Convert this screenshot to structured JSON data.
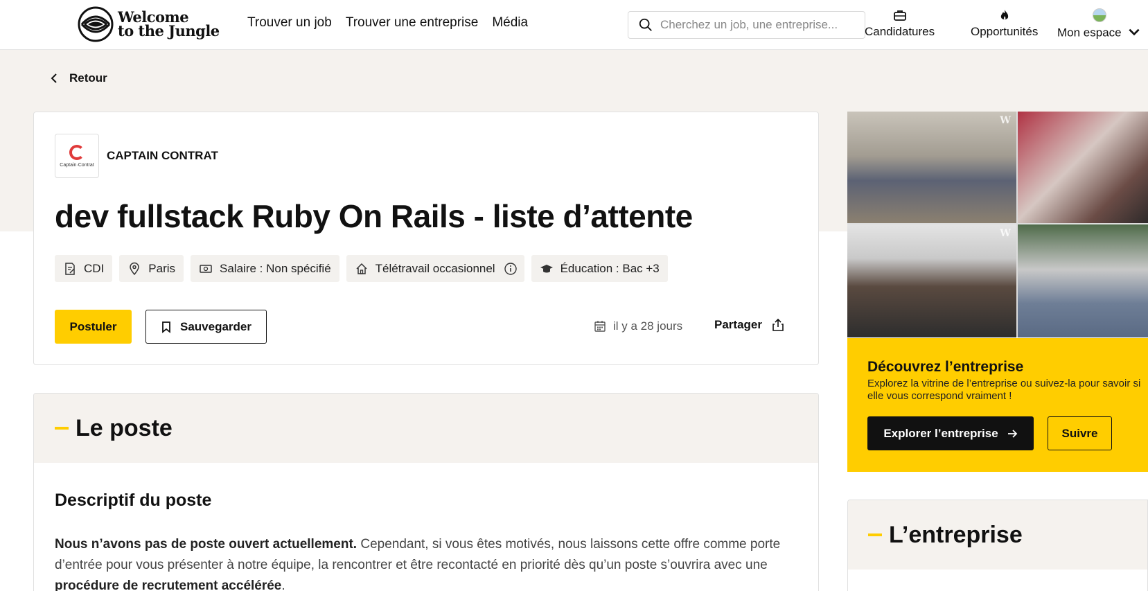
{
  "header": {
    "logo_line1": "Welcome",
    "logo_line2": "to the Jungle",
    "nav": [
      "Trouver un job",
      "Trouver une entreprise",
      "Média"
    ],
    "search_placeholder": "Cherchez un job, une entreprise...",
    "candidatures": "Candidatures",
    "opportunites": "Opportunités",
    "mon_espace": "Mon espace"
  },
  "back_label": "Retour",
  "job": {
    "company_name": "CAPTAIN CONTRAT",
    "company_logo_text": "Captain·Contrat",
    "title": "dev fullstack Ruby On Rails - liste d’attente",
    "tags": {
      "contract": "CDI",
      "location": "Paris",
      "salary": "Salaire :  Non spécifié",
      "remote": "Télétravail occasionnel",
      "education": "Éducation :  Bac +3"
    },
    "apply_label": "Postuler",
    "save_label": "Sauvegarder",
    "posted": "il y a 28 jours",
    "share_label": "Partager"
  },
  "poste": {
    "heading": "Le poste",
    "subheading": "Descriptif du poste",
    "para_bold": "Nous n’avons pas de poste ouvert actuellement.",
    "para_text": " Cependant, si vous êtes motivés, nous laissons cette offre comme porte d’entrée pour vous présenter à notre équipe, la rencontrer et être recontacté en priorité dès qu’un poste s’ouvrira avec une ",
    "para_bold2": "procédure de recrutement accélérée",
    "para_end": "."
  },
  "sidebar": {
    "discover_title": "Découvrez l’entreprise",
    "discover_text": "Explorez la vitrine de l’entreprise ou suivez-la pour savoir si elle vous correspond vraiment !",
    "explore_label": "Explorer l’entreprise",
    "follow_label": "Suivre",
    "entreprise_heading": "L’entreprise",
    "watermark": "W"
  },
  "colors": {
    "accent": "#ffcd00",
    "beige": "#f5f2ee"
  }
}
